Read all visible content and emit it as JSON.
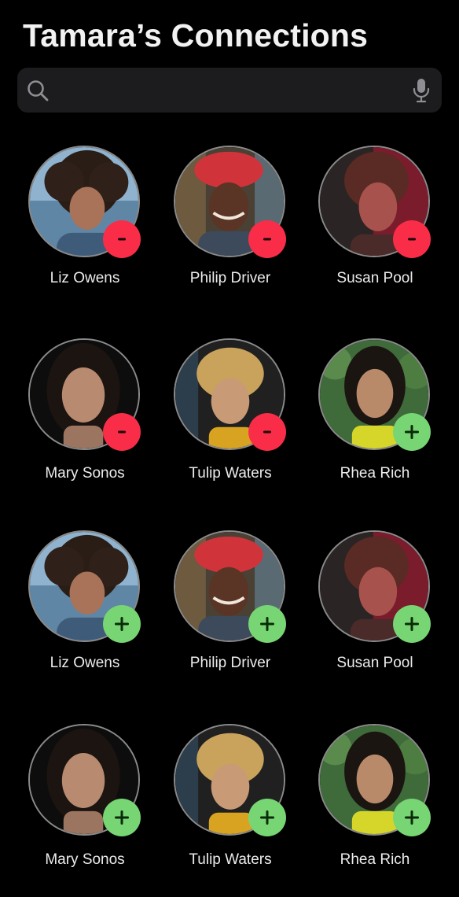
{
  "header": {
    "title": "Tamara’s Connections"
  },
  "search": {
    "placeholder": "",
    "value": "",
    "left_icon": "search-icon",
    "right_icon": "mic-icon"
  },
  "colors": {
    "remove": "#fa2d48",
    "add": "#77d573",
    "background": "#000000",
    "search_bg": "#1c1c1e"
  },
  "connections": [
    {
      "name": "Liz Owens",
      "action": "remove",
      "icon": "minus-icon"
    },
    {
      "name": "Philip Driver",
      "action": "remove",
      "icon": "minus-icon"
    },
    {
      "name": "Susan Pool",
      "action": "remove",
      "icon": "minus-icon"
    },
    {
      "name": "Mary Sonos",
      "action": "remove",
      "icon": "minus-icon"
    },
    {
      "name": "Tulip Waters",
      "action": "remove",
      "icon": "minus-icon"
    },
    {
      "name": "Rhea Rich",
      "action": "add",
      "icon": "plus-icon"
    },
    {
      "name": "Liz Owens",
      "action": "add",
      "icon": "plus-icon"
    },
    {
      "name": "Philip Driver",
      "action": "add",
      "icon": "plus-icon"
    },
    {
      "name": "Susan Pool",
      "action": "add",
      "icon": "plus-icon"
    },
    {
      "name": "Mary Sonos",
      "action": "add",
      "icon": "plus-icon"
    },
    {
      "name": "Tulip Waters",
      "action": "add",
      "icon": "plus-icon"
    },
    {
      "name": "Rhea Rich",
      "action": "add",
      "icon": "plus-icon"
    }
  ]
}
